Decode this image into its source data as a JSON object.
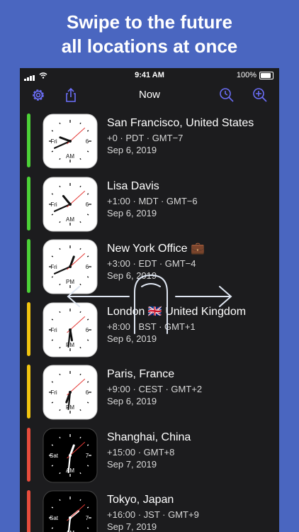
{
  "headline": {
    "line1": "Swipe to the future",
    "line2": "all locations at once"
  },
  "status_bar": {
    "time": "9:41 AM",
    "battery": "100%"
  },
  "nav": {
    "title": "Now",
    "icons": [
      "gear-icon",
      "share-icon",
      "clock-search-icon",
      "zoom-in-icon"
    ]
  },
  "colors": {
    "green": "#4cd137",
    "yellow": "#f1c40f",
    "red": "#e74c3c",
    "accent": "#5b5ef5"
  },
  "locations": [
    {
      "city": "San Francisco, United States",
      "meta": "+0 · PDT · GMT−7",
      "date": "Sep 6, 2019",
      "day": "Fri",
      "date_num": "6",
      "ampm": "AM",
      "dark": false,
      "bar": "green",
      "hour": 9.68,
      "minute": 41,
      "second": 8
    },
    {
      "city": "Lisa Davis",
      "meta": "+1:00 · MDT · GMT−6",
      "date": "Sep 6, 2019",
      "day": "Fri",
      "date_num": "6",
      "ampm": "AM",
      "dark": false,
      "bar": "green",
      "hour": 10.68,
      "minute": 41,
      "second": 8
    },
    {
      "city": "New York Office 💼",
      "meta": "+3:00 · EDT · GMT−4",
      "date": "Sep 6, 2019",
      "day": "Fri",
      "date_num": "6",
      "ampm": "PM",
      "dark": false,
      "bar": "green",
      "hour": 12.68,
      "minute": 41,
      "second": 8
    },
    {
      "city": "London 🇬🇧 United Kingdom",
      "meta": "+8:00 · BST · GMT+1",
      "date": "Sep 6, 2019",
      "day": "Fri",
      "date_num": "6",
      "ampm": "PM",
      "dark": false,
      "bar": "yellow",
      "hour": 5.68,
      "minute": 31,
      "second": 8
    },
    {
      "city": "Paris, France",
      "meta": "+9:00 · CEST · GMT+2",
      "date": "Sep 6, 2019",
      "day": "Fri",
      "date_num": "6",
      "ampm": "PM",
      "dark": false,
      "bar": "yellow",
      "hour": 6.68,
      "minute": 31,
      "second": 8
    },
    {
      "city": "Shanghai, China",
      "meta": "+15:00 · GMT+8",
      "date": "Sep 7, 2019",
      "day": "Sat",
      "date_num": "7",
      "ampm": "AM",
      "dark": true,
      "bar": "red",
      "hour": 0.68,
      "minute": 31,
      "second": 8
    },
    {
      "city": "Tokyo, Japan",
      "meta": "+16:00 · JST · GMT+9",
      "date": "Sep 7, 2019",
      "day": "Sat",
      "date_num": "7",
      "ampm": "AM",
      "dark": true,
      "bar": "red",
      "hour": 1.68,
      "minute": 31,
      "second": 8
    }
  ]
}
